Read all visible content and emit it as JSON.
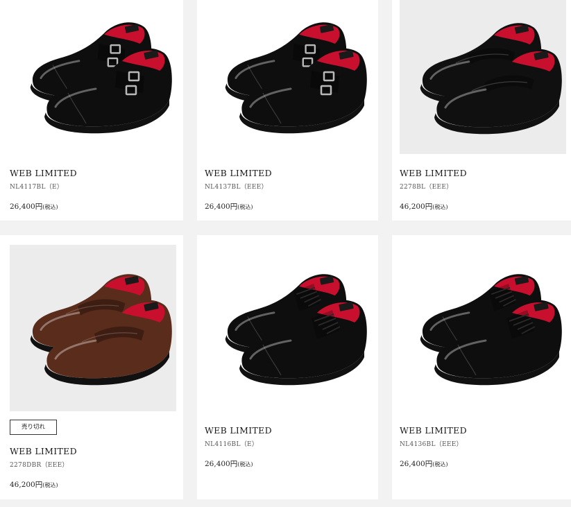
{
  "products": [
    {
      "title": "WEB LIMITED",
      "code": "NL4117BL（E）",
      "price": "26,400円",
      "tax": "(税込)",
      "style": "double-monk",
      "color": "#0e0e0e"
    },
    {
      "title": "WEB LIMITED",
      "code": "NL4137BL（EEE）",
      "price": "26,400円",
      "tax": "(税込)",
      "style": "double-monk",
      "color": "#0e0e0e"
    },
    {
      "title": "WEB LIMITED",
      "code": "2278BL（EEE）",
      "price": "46,200円",
      "tax": "(税込)",
      "style": "loafer",
      "color": "#101010"
    },
    {
      "title": "WEB LIMITED",
      "code": "2278DBR（EEE）",
      "price": "46,200円",
      "tax": "(税込)",
      "style": "loafer",
      "color": "#5a2c1c",
      "badge": "売り切れ"
    },
    {
      "title": "WEB LIMITED",
      "code": "NL4116BL（E）",
      "price": "26,400円",
      "tax": "(税込)",
      "style": "oxford",
      "color": "#0e0e0e"
    },
    {
      "title": "WEB LIMITED",
      "code": "NL4136BL（EEE）",
      "price": "26,400円",
      "tax": "(税込)",
      "style": "oxford",
      "color": "#0e0e0e"
    }
  ],
  "colors": {
    "page_bg": "#f2f2f2",
    "card_bg": "#ffffff",
    "insole_red": "#c8102e",
    "insole_label": "#1a1a1a",
    "buckle": "#b9b9b9"
  }
}
